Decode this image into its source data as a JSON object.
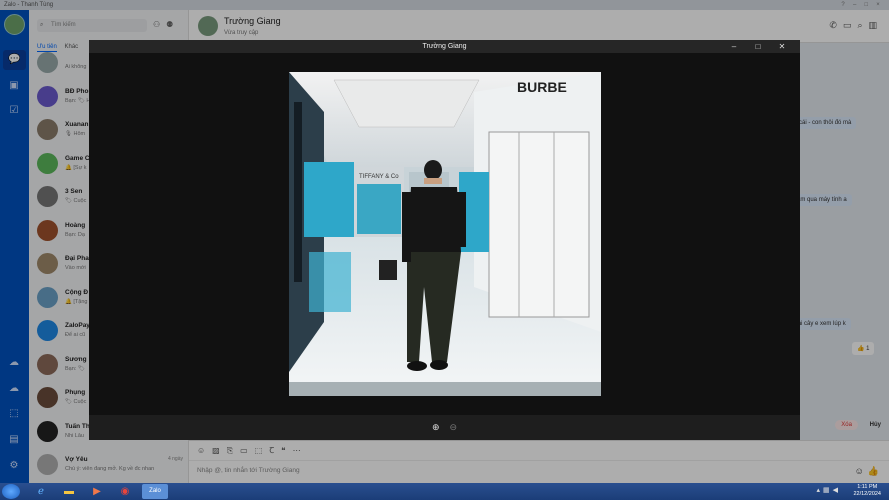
{
  "app": {
    "title": "Zalo - Thanh Tùng"
  },
  "sidebar": {
    "search_placeholder": "Tìm kiếm",
    "tabs": [
      "Ưu tiên",
      "Khác"
    ],
    "chats": [
      {
        "name": "",
        "preview": "Ai không",
        "time": "",
        "color": "#9aa"
      },
      {
        "name": "BĐ Phong",
        "preview": "Bạn: 🏷 Hi",
        "time": "",
        "color": "#6a5acd",
        "initials": "BP"
      },
      {
        "name": "Xuanan",
        "preview": "🎙 Hôm",
        "time": "",
        "color": "#8b7d6b"
      },
      {
        "name": "Game C",
        "preview": "🔔 [Sự k",
        "time": "",
        "color": "#5cb85c"
      },
      {
        "name": "3 Sen",
        "preview": "🏷 Cuộc",
        "time": "",
        "color": "#777"
      },
      {
        "name": "Hoàng",
        "preview": "Bạn: Dạ",
        "time": "",
        "color": "#a0522d"
      },
      {
        "name": "Đại Pha",
        "preview": "Vào mới",
        "time": "",
        "color": "#9f8a6a"
      },
      {
        "name": "Cộng Đ",
        "preview": "🔔 [Tặng",
        "time": "",
        "color": "#6aa1c7"
      },
      {
        "name": "ZaloPay",
        "preview": "Để ai cũ",
        "time": "",
        "color": "#1e88e5"
      },
      {
        "name": "Sương",
        "preview": "Bạn: 🏷",
        "time": "",
        "color": "#8c6b5a"
      },
      {
        "name": "Phụng",
        "preview": "🏷 Cuộc",
        "time": "",
        "color": "#6b4c3b"
      },
      {
        "name": "Tuấn Th",
        "preview": "Nhi Lâu",
        "time": "",
        "color": "#222"
      },
      {
        "name": "Vợ Yêu",
        "preview": "Chú ý: viên đang mở. Kg về đc nhan",
        "time": "4 ngày",
        "color": "#b0b0b0"
      }
    ]
  },
  "conversation": {
    "name": "Trường Giang",
    "status": "Vừa truy cập",
    "bubbles": [
      "nhận cái - con thôi đó mà",
      "telegam qua máy tính a",
      "thử vài cây e xem lúp k"
    ],
    "reaction": "👍 1",
    "input_placeholder": "Nhập @, tin nhắn tới Trường Giang",
    "delete_label": "Xóa",
    "cancel_label": "Hủy"
  },
  "viewer": {
    "title": "Trường Giang",
    "zoom_in": "⊕",
    "zoom_out": "⊖",
    "store_sign_1": "BURBE",
    "store_sign_2": "TIFFANY & Co"
  },
  "taskbar": {
    "time": "1:11 PM",
    "date": "22/12/2024"
  }
}
